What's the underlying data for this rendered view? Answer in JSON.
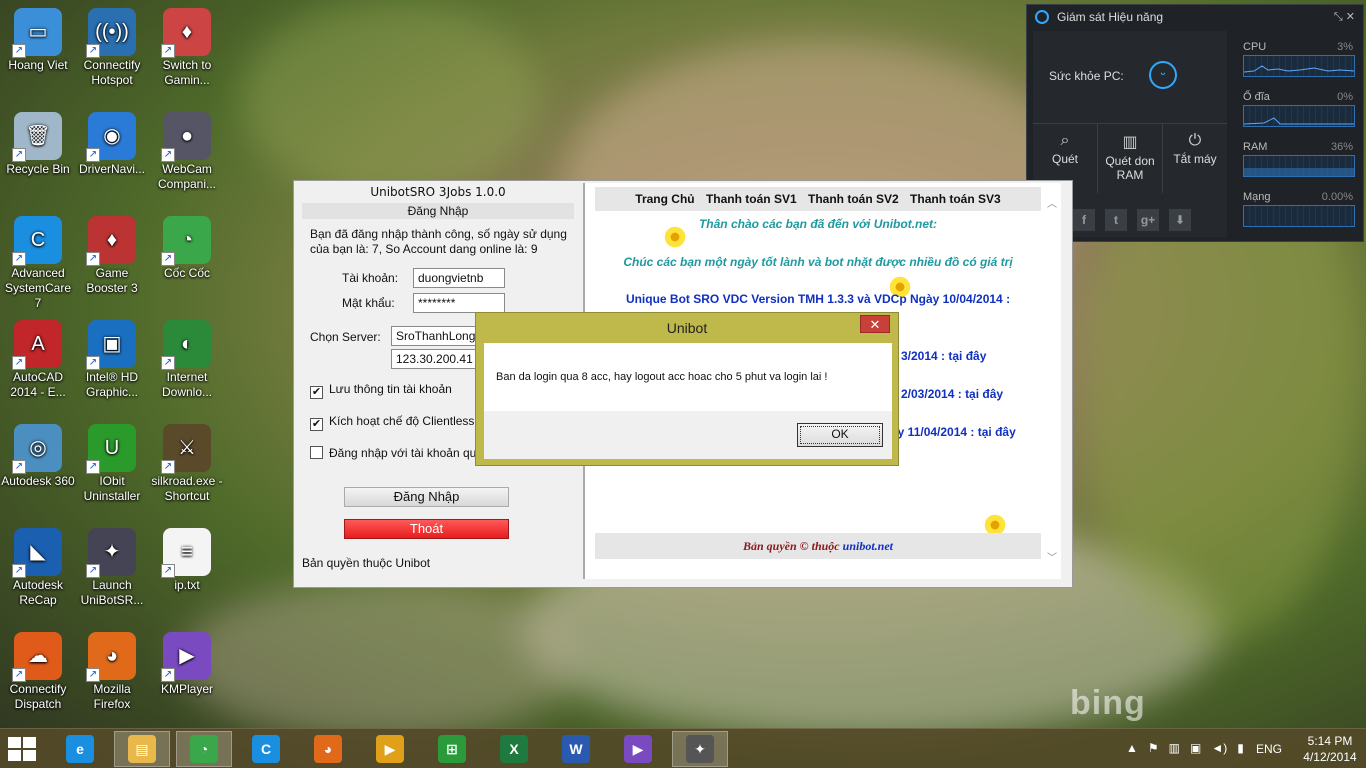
{
  "desktop_icons": [
    {
      "label": "Hoang Viet",
      "color": "#3a8fd8",
      "glyph": "▭"
    },
    {
      "label": "Connectify Hotspot",
      "color": "#2a6fb0",
      "glyph": "((•))"
    },
    {
      "label": "Switch to Gamin...",
      "color": "#c44",
      "glyph": "♦"
    },
    {
      "label": "Recycle Bin",
      "color": "#9fb7c9",
      "glyph": "🗑"
    },
    {
      "label": "DriverNavi...",
      "color": "#2a7ad8",
      "glyph": "◉"
    },
    {
      "label": "WebCam Compani...",
      "color": "#556",
      "glyph": "●"
    },
    {
      "label": "Advanced SystemCare 7",
      "color": "#1a8fe0",
      "glyph": "C"
    },
    {
      "label": "Game Booster 3",
      "color": "#b33",
      "glyph": "♦"
    },
    {
      "label": "Cốc Cốc",
      "color": "#3aa84a",
      "glyph": "◔"
    },
    {
      "label": "AutoCAD 2014 - E...",
      "color": "#c0262a",
      "glyph": "A"
    },
    {
      "label": "Intel® HD Graphic...",
      "color": "#1a6fc0",
      "glyph": "▣"
    },
    {
      "label": "Internet Downlo...",
      "color": "#2a8a3a",
      "glyph": "◐"
    },
    {
      "label": "Autodesk 360",
      "color": "#4a8fc0",
      "glyph": "◎"
    },
    {
      "label": "IObit Uninstaller",
      "color": "#2a9a2a",
      "glyph": "U"
    },
    {
      "label": "silkroad.exe - Shortcut",
      "color": "#5a4a2a",
      "glyph": "⚔"
    },
    {
      "label": "Autodesk ReCap",
      "color": "#1a5fb0",
      "glyph": "◣"
    },
    {
      "label": "Launch UniBotSR...",
      "color": "#445",
      "glyph": "✦"
    },
    {
      "label": "ip.txt",
      "color": "#f4f4f4",
      "glyph": "≡"
    },
    {
      "label": "Connectify Dispatch",
      "color": "#e05a1a",
      "glyph": "☁"
    },
    {
      "label": "Mozilla Firefox",
      "color": "#e06a1a",
      "glyph": "◕"
    },
    {
      "label": "KMPlayer",
      "color": "#7a4ac0",
      "glyph": "▶"
    }
  ],
  "perf_gadget": {
    "title": "Giám sát Hiệu năng",
    "controls": "⤡ ✕",
    "health_label": "Sức khỏe PC:",
    "actions": [
      {
        "label": "Quét",
        "icon": "search-icon",
        "glyph": "⌕"
      },
      {
        "label": "Quét don RAM",
        "icon": "ram-icon",
        "glyph": "▥"
      },
      {
        "label": "Tắt máy",
        "icon": "power-icon",
        "glyph": "⏻"
      }
    ],
    "social": [
      "f",
      "t",
      "g+",
      "⬇"
    ],
    "meters": [
      {
        "name": "CPU",
        "pct": "3%"
      },
      {
        "name": "Ổ đĩa",
        "pct": "0%"
      },
      {
        "name": "RAM",
        "pct": "36%"
      },
      {
        "name": "Mạng",
        "pct": "0.00%"
      }
    ]
  },
  "unibot": {
    "title": "UnibotSRO 3Jobs 1.0.0",
    "section": "Đăng Nhập",
    "message": "Bạn đã đăng nhập thành công, số ngày sử dụng của bạn là: 7, So Account dang online là: 9",
    "account_label": "Tài khoản:",
    "account_value": "duongvietnb",
    "password_label": "Mật khẩu:",
    "password_value": "********",
    "server_label": "Chọn Server:",
    "server_value": "SroThanhLong",
    "ip_value": "123.30.200.41",
    "checkboxes": [
      {
        "label": "Lưu thông tin tài khoản",
        "checked": "✔"
      },
      {
        "label": "Kích hoạt chế độ Clientless",
        "checked": "✔"
      },
      {
        "label": "Đăng nhập với tài khoản qu",
        "checked": ""
      }
    ],
    "login_button": "Đăng Nhập",
    "exit_button": "Thoát",
    "copyright": "Bản quyền thuộc Unibot",
    "web": {
      "nav": [
        "Trang Chủ",
        "Thanh toán SV1",
        "Thanh toán SV2",
        "Thanh toán SV3"
      ],
      "greet1": "Thân chào các bạn đã đến với Unibot.net:",
      "greet2": "Chúc các bạn một ngày tốt lành và bot nhặt được nhiều đồ có giá trị",
      "version": "Unique Bot SRO VDC Version TMH 1.3.3 và VDC",
      "version_tail": "p Ngày 10/04/2014 :",
      "line1": "3/2014 : ",
      "line2": "2/03/2014 : ",
      "line3": "ày 11/04/2014 : ",
      "link_text": "tại đây",
      "footer_text": "Bản quyền © thuộc ",
      "footer_link": "unibot.net"
    }
  },
  "dialog": {
    "title": "Unibot",
    "close": "✕",
    "message": "Ban da login qua 8 acc, hay logout acc hoac cho 5 phut va login lai !",
    "ok_label": "OK"
  },
  "wallpaper_watermark": "bing",
  "taskbar": {
    "items": [
      {
        "name": "internet-explorer",
        "glyph": "e",
        "color": "#1a8fe0"
      },
      {
        "name": "file-explorer",
        "glyph": "▤",
        "color": "#e8b84a"
      },
      {
        "name": "coc-coc",
        "glyph": "◔",
        "color": "#3aa84a"
      },
      {
        "name": "advanced-systemcare",
        "glyph": "C",
        "color": "#1a8fe0"
      },
      {
        "name": "firefox",
        "glyph": "◕",
        "color": "#e06a1a"
      },
      {
        "name": "media-player",
        "glyph": "▶",
        "color": "#e0a01a"
      },
      {
        "name": "store",
        "glyph": "⊞",
        "color": "#2a9a3a"
      },
      {
        "name": "excel",
        "glyph": "X",
        "color": "#1e7a3e"
      },
      {
        "name": "word",
        "glyph": "W",
        "color": "#2a5ab0"
      },
      {
        "name": "kmplayer",
        "glyph": "▶",
        "color": "#7a4ac0"
      },
      {
        "name": "unibot",
        "glyph": "✦",
        "color": "#555"
      }
    ],
    "tray_icons": [
      "▲",
      "⚑",
      "▥",
      "▣",
      "◄)",
      "▮"
    ],
    "language": "ENG",
    "time": "5:14 PM",
    "date": "4/12/2014"
  }
}
